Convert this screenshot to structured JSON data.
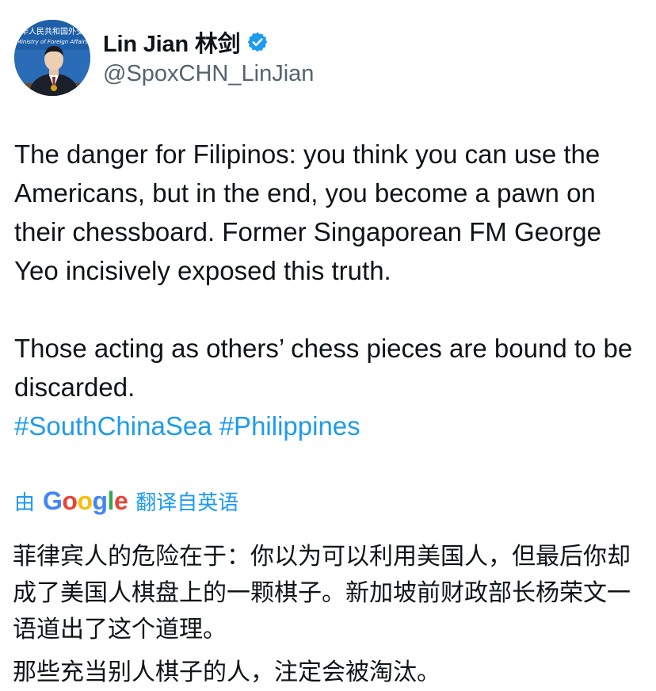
{
  "author": {
    "name": "Lin Jian 林剑",
    "handle": "@SpoxCHN_LinJian",
    "verified_icon": "verified-badge-icon",
    "avatar_banner_text": "中华人民共和国外交部",
    "avatar_banner_text_en": "Ministry of Foreign Affairs"
  },
  "tweet": {
    "paragraph1": "The danger for Filipinos: you think you can use the Americans, but in the end, you become a pawn on their chessboard. Former Singaporean FM George Yeo incisively exposed this truth.",
    "paragraph2": "Those acting as others’ chess pieces are bound to be discarded.",
    "hashtags": [
      "#SouthChinaSea",
      "#Philippines"
    ]
  },
  "translation": {
    "prefix": "由",
    "provider": "Google",
    "suffix": "翻译自英语",
    "paragraph1": "菲律宾人的危险在于：你以为可以利用美国人，但最后你却成了美国人棋盘上的一颗棋子。新加坡前财政部长杨荣文一语道出了这个道理。",
    "paragraph2": "那些充当别人棋子的人，注定会被淘汰。"
  },
  "colors": {
    "link": "#1d9bf0",
    "text": "#0f1419",
    "secondary": "#536471",
    "google_blue": "#4285f4",
    "google_red": "#ea4335",
    "google_yellow": "#fbbc05",
    "google_green": "#34a853"
  }
}
